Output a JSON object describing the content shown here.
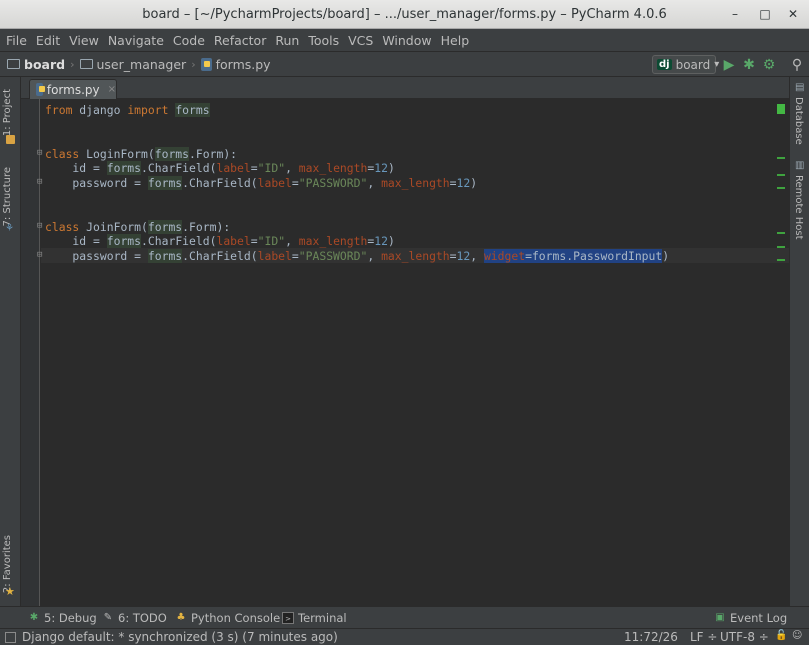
{
  "window": {
    "title": "board – [~/PycharmProjects/board] – .../user_manager/forms.py – PyCharm 4.0.6",
    "controls": {
      "minimize": "–",
      "maximize": "□",
      "close": "✕"
    }
  },
  "menu": [
    "File",
    "Edit",
    "View",
    "Navigate",
    "Code",
    "Refactor",
    "Run",
    "Tools",
    "VCS",
    "Window",
    "Help"
  ],
  "breadcrumbs": [
    "board",
    "user_manager",
    "forms.py"
  ],
  "run_config": {
    "badge": "dj",
    "label": "board",
    "arrow": "▾"
  },
  "toolbar_icons": [
    "run-icon",
    "debug-icon",
    "coverage-icon",
    "search-icon"
  ],
  "left_tabs": {
    "project": "1: Project",
    "structure": "7: Structure",
    "favorites": "2: Favorites"
  },
  "right_tabs": {
    "database": "Database",
    "remote_host": "Remote Host"
  },
  "editor": {
    "tab_label": "forms.py",
    "tab_close": "×"
  },
  "bottom_tools": {
    "debug": "5: Debug",
    "todo": "6: TODO",
    "python_console": "Python Console",
    "terminal": "Terminal",
    "event_log": "Event Log"
  },
  "status": {
    "message": "Django default: * synchronized (3 s) (7 minutes ago)",
    "position": "11:72/26",
    "line_sep": "LF ÷",
    "encoding": "UTF-8 ÷"
  },
  "colors": {
    "keyword": "#cc7832",
    "string": "#6a8759",
    "param": "#aa4926",
    "number": "#6897bb",
    "selection": "#214283"
  }
}
